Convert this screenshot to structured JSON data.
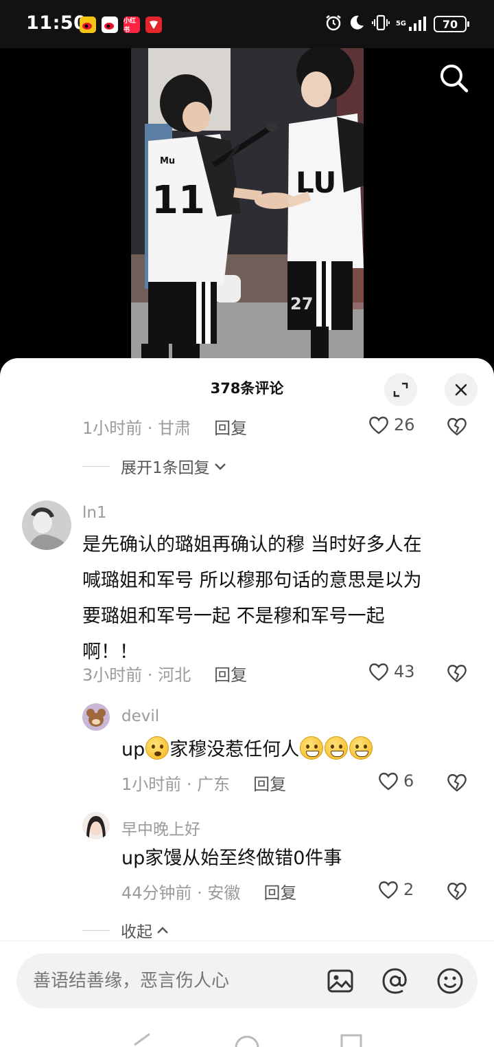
{
  "status_bar": {
    "time": "11:50",
    "app_badge_label": "小红书",
    "network": "5G",
    "battery": "70"
  },
  "sheet": {
    "title": "378条评论"
  },
  "top_comment_meta": {
    "time_location": "1小时前 · 甘肃",
    "reply": "回复",
    "likes": "26"
  },
  "expand": {
    "label": "展开1条回复"
  },
  "comment": {
    "username": "ln1",
    "lines": [
      "是先确认的璐姐再确认的穆 当时好多人在",
      "喊璐姐和军号 所以穆那句话的意思是以为",
      "要璐姐和军号一起 不是穆和军号一起",
      "啊！！"
    ],
    "time_location": "3小时前 · 河北",
    "reply": "回复",
    "likes": "43"
  },
  "replies": [
    {
      "username": "devil",
      "text_before": "up",
      "text_after": "家穆没惹任何人",
      "time_location": "1小时前 · 广东",
      "reply": "回复",
      "likes": "6"
    },
    {
      "username": "早中晚上好",
      "text": "up家馒从始至终做错0件事",
      "time_location": "44分钟前 · 安徽",
      "reply": "回复",
      "likes": "2"
    }
  ],
  "collapse": {
    "label": "收起"
  },
  "input": {
    "placeholder": "善语结善缘，恶言伤人心"
  },
  "icons": {
    "search": "search-icon",
    "expand": "expand-icon",
    "close": "close-icon",
    "heart": "heart-icon",
    "broken_heart": "broken-heart-icon",
    "image": "image-icon",
    "mention": "at-icon",
    "emoji": "emoji-icon"
  }
}
